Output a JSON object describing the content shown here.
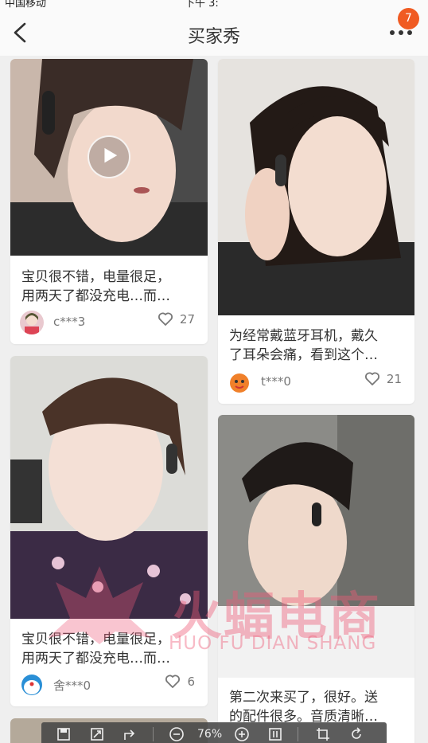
{
  "statusbar": {
    "carrier": "中国移动",
    "center": "下午 3:"
  },
  "header": {
    "title": "买家秀",
    "badge_count": "7"
  },
  "feed": [
    {
      "caption_line1": "宝贝很不错，电量很足，",
      "caption_line2": "用两天了都没充电…而…",
      "user": "c***3",
      "likes": "27",
      "has_video": true,
      "avatar": "girl-avatar"
    },
    {
      "caption_line1": "为经常戴蓝牙耳机，戴久",
      "caption_line2": "了耳朵会痛，看到这个…",
      "user": "t***0",
      "likes": "21",
      "has_video": false,
      "avatar": "cartoon-orange-avatar"
    },
    {
      "caption_line1": "宝贝很不错，电量很足，",
      "caption_line2": "用两天了都没充电…而…",
      "user": "舍***0",
      "likes": "6",
      "has_video": false,
      "avatar": "doraemon-avatar"
    },
    {
      "caption_line1": "第二次来买了，很好。送",
      "caption_line2": "的配件很多。音质清晰…",
      "user": "",
      "likes": "",
      "has_video": false,
      "avatar": ""
    }
  ],
  "watermark": {
    "chinese": "火蝠电商",
    "pinyin": "HUO FU DIAN SHANG"
  },
  "viewer_toolbar": {
    "zoom": "76%"
  },
  "colors": {
    "accent": "#f05b22",
    "background": "#efefef",
    "watermark": "#ee5a78"
  }
}
